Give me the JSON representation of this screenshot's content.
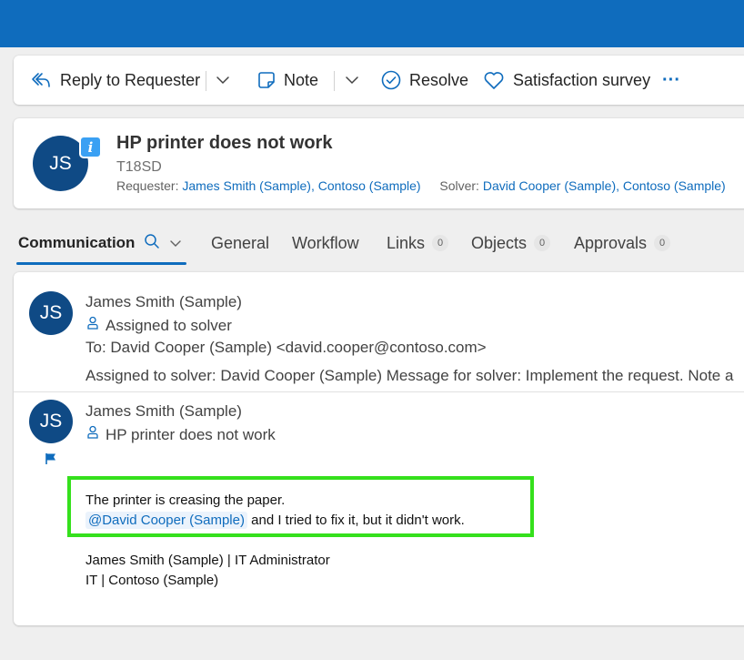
{
  "toolbar": {
    "reply_label": "Reply to Requester",
    "note_label": "Note",
    "resolve_label": "Resolve",
    "survey_label": "Satisfaction survey",
    "more_label": "···"
  },
  "ticket": {
    "avatar_initials": "JS",
    "title": "HP printer does not work",
    "id": "T18SD",
    "requester_label": "Requester:",
    "requester_value": "James Smith (Sample), Contoso (Sample)",
    "solver_label": "Solver:",
    "solver_value": "David Cooper (Sample), Contoso (Sample)"
  },
  "tabs": [
    {
      "label": "Communication"
    },
    {
      "label": "General"
    },
    {
      "label": "Workflow"
    },
    {
      "label": "Links",
      "badge": "0"
    },
    {
      "label": "Objects",
      "badge": "0"
    },
    {
      "label": "Approvals",
      "badge": "0"
    }
  ],
  "messages": [
    {
      "avatar": "JS",
      "author": "James Smith (Sample)",
      "subject": "Assigned to solver",
      "to": "To: David Cooper (Sample) <david.cooper@contoso.com>",
      "preview": "Assigned to solver: David Cooper (Sample) Message for solver: Implement the request. Note a"
    },
    {
      "avatar": "JS",
      "author": "James Smith (Sample)",
      "subject": "HP printer does not work",
      "body_line1": "The printer is creasing the paper.",
      "mention": "@David Cooper (Sample)",
      "body_line2_rest": "and I tried to fix it, but it didn't work.",
      "signature_line1": "James Smith (Sample) | IT Administrator",
      "signature_line2": "IT | Contoso (Sample)"
    }
  ],
  "colors": {
    "brand": "#0f6cbd",
    "avatar": "#0f4a85",
    "highlight": "#35e01c"
  }
}
